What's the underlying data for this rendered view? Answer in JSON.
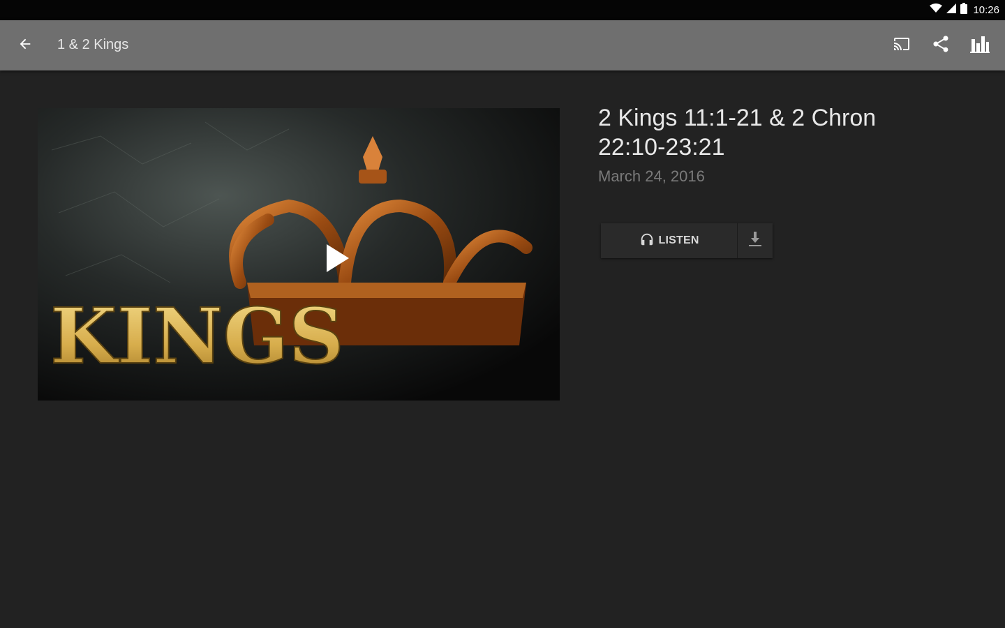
{
  "status": {
    "time": "10:26",
    "icons": [
      "wifi-icon",
      "signal-icon",
      "battery-icon"
    ]
  },
  "appbar": {
    "back_icon": "arrow-back-icon",
    "title": "1 & 2 Kings",
    "actions": [
      "cast-icon",
      "share-icon",
      "stats-icon"
    ]
  },
  "media": {
    "artwork_text": "KINGS",
    "play_icon": "play-icon"
  },
  "sermon": {
    "title": "2 Kings 11:1-21 & 2 Chron 22:10-23:21",
    "date": "March 24, 2016",
    "listen_label": "LISTEN",
    "listen_icon": "headphones-icon",
    "download_icon": "download-icon"
  },
  "colors": {
    "background": "#222222",
    "appbar": "#6f6f6f",
    "statusbar": "#050505",
    "title_text": "#e8e8e8",
    "date_text": "#7a7a7a",
    "gold": "#d9b45a"
  }
}
